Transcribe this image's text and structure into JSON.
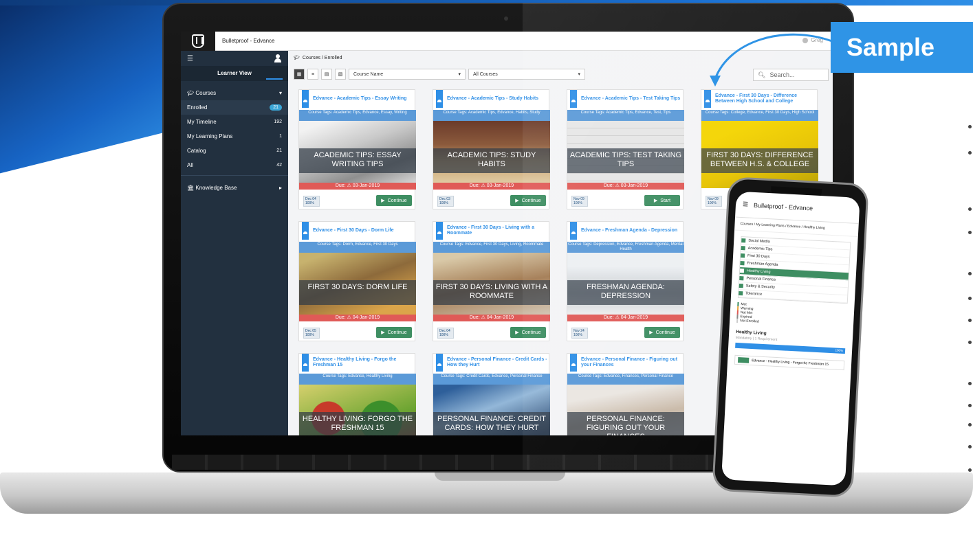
{
  "app": {
    "title": "Bulletproof - Edvance",
    "user": "Greg"
  },
  "sidebar": {
    "view_label": "Learner View",
    "courses_label": "Courses",
    "items": [
      {
        "label": "Enrolled",
        "count": "21"
      },
      {
        "label": "My Timeline",
        "count": "192"
      },
      {
        "label": "My Learning Plans",
        "count": "1"
      },
      {
        "label": "Catalog",
        "count": "21"
      },
      {
        "label": "All",
        "count": "42"
      }
    ],
    "kb_label": "Knowledge Base"
  },
  "breadcrumb": "Courses / Enrolled",
  "toolbar": {
    "sort_select": "Course Name",
    "filter_select": "All Courses",
    "search_placeholder": "Search..."
  },
  "cards": [
    {
      "title": "Edvance - Academic Tips - Essay Writing",
      "tags": "Course Tags: Academic Tips, Edvance, Essay, Writing",
      "image_text": "ACADEMIC TIPS: ESSAY WRITING TIPS",
      "due": "Due: ⚠ 03-Jan-2019",
      "date": "Dec 04",
      "progress": "100%",
      "action": "Continue"
    },
    {
      "title": "Edvance - Academic Tips - Study Habits",
      "tags": "Course Tags: Academic Tips, Edvance, Habits, Study",
      "image_text": "ACADEMIC TIPS: STUDY HABITS",
      "due": "Due: ⚠ 03-Jan-2019",
      "date": "Dec 03",
      "progress": "100%",
      "action": "Continue"
    },
    {
      "title": "Edvance - Academic Tips - Test Taking Tips",
      "tags": "Course Tags: Academic Tips, Edvance, Test, Tips",
      "image_text": "ACADEMIC TIPS: TEST TAKING TIPS",
      "due": "Due: ⚠ 03-Jan-2019",
      "date": "Nov 09",
      "progress": "100%",
      "action": "Start"
    },
    {
      "title": "Edvance - First 30 Days - Difference Between High School and College",
      "tags": "Course Tags: College, Edvance, First 30 Days, High School",
      "image_text": "FIRST 30 DAYS: DIFFERENCE BETWEEN H.S. & COLLEGE",
      "due": "",
      "date": "Nov 09",
      "progress": "100%",
      "action": ""
    },
    {
      "title": "Edvance - First 30 Days - Dorm Life",
      "tags": "Course Tags: Dorm, Edvance, First 30 Days",
      "image_text": "FIRST 30 DAYS: DORM LIFE",
      "due": "Due: ⚠ 04-Jan-2019",
      "date": "Dec 05",
      "progress": "100%",
      "action": "Continue"
    },
    {
      "title": "Edvance - First 30 Days - Living with a Roommate",
      "tags": "Course Tags: Edvance, First 30 Days, Living, Roommate",
      "image_text": "FIRST 30 DAYS: LIVING WITH A ROOMMATE",
      "due": "Due: ⚠ 04-Jan-2019",
      "date": "Dec 04",
      "progress": "100%",
      "action": "Continue"
    },
    {
      "title": "Edvance - Freshman Agenda - Depression",
      "tags": "Course Tags: Depression, Edvance, Freshman Agenda, Mental Health",
      "image_text": "FRESHMAN AGENDA: DEPRESSION",
      "due": "Due: ⚠ 04-Jan-2019",
      "date": "Nov 24",
      "progress": "100%",
      "action": "Continue"
    },
    {
      "title": "Edvance - Healthy Living - Forgo the Freshman 15",
      "tags": "Course Tags: Edvance, Healthy Living",
      "image_text": "HEALTHY LIVING: FORGO THE FRESHMAN 15",
      "due": "",
      "date": "",
      "progress": "",
      "action": ""
    },
    {
      "title": "Edvance - Personal Finance - Credit Cards - How they Hurt",
      "tags": "Course Tags: Credit Cards, Edvance, Personal Finance",
      "image_text": "PERSONAL FINANCE: CREDIT CARDS: HOW THEY HURT",
      "due": "",
      "date": "",
      "progress": "",
      "action": ""
    },
    {
      "title": "Edvance - Personal Finance - Figuring out your Finances",
      "tags": "Course Tags: Edvance, Finances, Personal Finance",
      "image_text": "PERSONAL FINANCE: FIGURING OUT YOUR FINANCES",
      "due": "",
      "date": "",
      "progress": "",
      "action": ""
    }
  ],
  "banner": {
    "label": "Sample"
  },
  "phone": {
    "title": "Bulletproof - Edvance",
    "breadcrumb": "Courses / My Learning Plans / Edvance / Healthy Living",
    "plan_items": [
      "Social Media",
      "Academic Tips",
      "First 30 Days",
      "Freshman Agenda",
      "Healthy Living",
      "Personal Finance",
      "Safety & Security",
      "Tolerance"
    ],
    "legend": [
      "Met",
      "Warning",
      "Not Met",
      "Expired",
      "Not Enrolled"
    ],
    "plan_title": "Healthy Living",
    "plan_sub": "Mandatory | 1 Requirement",
    "plan_progress": "100%",
    "course": "Edvance - Healthy Living - Forgo the Freshman 15"
  },
  "colors": {
    "accent": "#2f8fe6",
    "sidebar": "#22303f",
    "due": "#e05a57",
    "button": "#3e8e62"
  }
}
